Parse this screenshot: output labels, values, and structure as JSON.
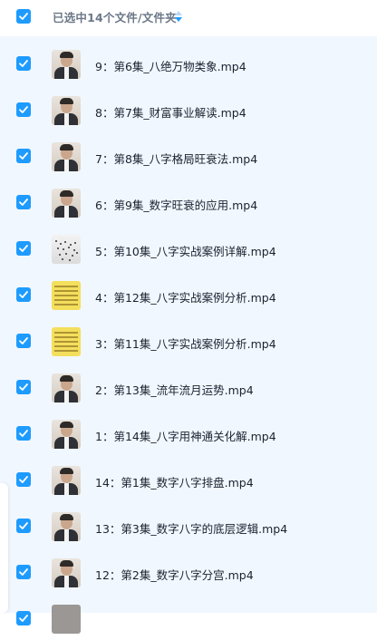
{
  "header": {
    "selection_text": "已选中14个文件/文件夹",
    "all_checked": true
  },
  "colors": {
    "checkbox": "#1e9bff",
    "list_bg": "#f1f7fe",
    "header_text": "#6b7787",
    "file_text": "#1b2330"
  },
  "files": [
    {
      "name": "9：第6集_八绝万物类象.mp4",
      "thumb": "person"
    },
    {
      "name": "8：第7集_财富事业解读.mp4",
      "thumb": "person"
    },
    {
      "name": "7：第8集_八字格局旺衰法.mp4",
      "thumb": "person"
    },
    {
      "name": "6：第9集_数字旺衰的应用.mp4",
      "thumb": "person"
    },
    {
      "name": "5：第10集_八字实战案例详解.mp4",
      "thumb": "dots"
    },
    {
      "name": "4：第12集_八字实战案例分析.mp4",
      "thumb": "chart"
    },
    {
      "name": "3：第11集_八字实战案例分析.mp4",
      "thumb": "chart"
    },
    {
      "name": "2：第13集_流年流月运势.mp4",
      "thumb": "person"
    },
    {
      "name": "1：第14集_八字用神通关化解.mp4",
      "thumb": "person"
    },
    {
      "name": "14：第1集_数字八字排盘.mp4",
      "thumb": "person"
    },
    {
      "name": "13：第3集_数字八字的底层逻辑.mp4",
      "thumb": "person"
    },
    {
      "name": "12：第2集_数字八字分宫.mp4",
      "thumb": "person"
    },
    {
      "name": "",
      "thumb": "gray"
    }
  ]
}
